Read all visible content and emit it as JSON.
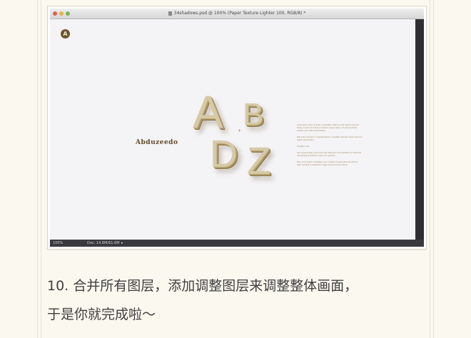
{
  "window": {
    "title": "34shadows.psd @ 100% (Paper Texture Lighter 100, RGB/8) *"
  },
  "artwork": {
    "badge_letter": "A",
    "brand_name": "Abduzeedo",
    "letters": [
      "A",
      "B",
      "D",
      "Z"
    ],
    "body_text": [
      "Lorem ipsum dolor sit amet, consectetur adipiscing elit. Sed do eiusmod tempor incididunt ut labore et dolore magna aliqua. Ut enim ad minim veniam, quis nostrud exercitation.",
      "Duis aute irure dolor in reprehenderit in voluptate velit esse cillum dolore eu fugiat nulla pariatur.",
      "Excepteur sint.",
      "Sed ut perspiciatis unde omnis iste natus error sit voluptatem accusantium doloremque laudantium, totam rem aperiam.",
      "Nemo enim ipsam voluptatem quia voluptas sit aspernatur aut odit aut fugit, sed quia consequuntur magni dolores eos qui ratione."
    ]
  },
  "statusbar": {
    "zoom": "100%",
    "doc_size": "Doc: 14.8M/61.6M"
  },
  "caption": {
    "line1": "10. 合并所有图层，添加调整图层来调整整体画面，",
    "line2": "于是你就完成啦～"
  }
}
